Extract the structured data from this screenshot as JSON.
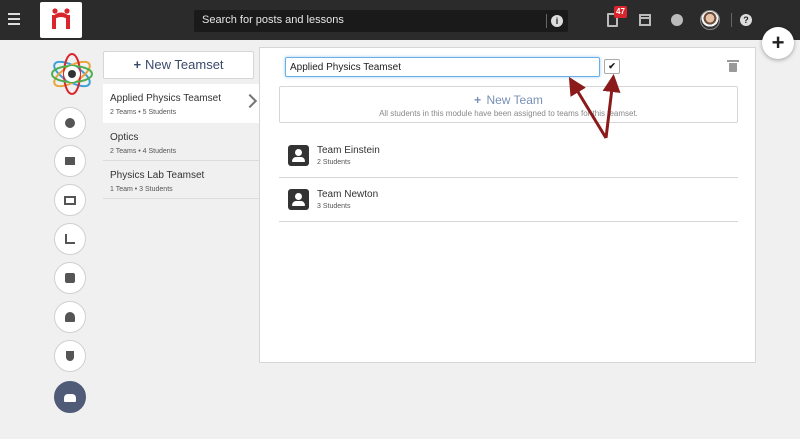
{
  "topbar": {
    "search_placeholder": "Search for posts and lessons",
    "notification_count": "47"
  },
  "fab": {
    "label": "+"
  },
  "teamsets": {
    "new_label": "New Teamset",
    "items": [
      {
        "name": "Applied Physics Teamset",
        "meta": "2 Teams • 5 Students"
      },
      {
        "name": "Optics",
        "meta": "2 Teams • 4 Students"
      },
      {
        "name": "Physics Lab Teamset",
        "meta": "1 Team • 3 Students"
      }
    ]
  },
  "editor": {
    "name_value": "Applied Physics Teamset",
    "new_team_label": "New Team",
    "new_team_note": "All students in this module have been assigned to teams for this teamset."
  },
  "teams": [
    {
      "name": "Team Einstein",
      "meta": "2 Students"
    },
    {
      "name": "Team Newton",
      "meta": "3 Students"
    }
  ],
  "colors": {
    "annotation_arrow": "#8b1a1a",
    "accent": "#4f5b77",
    "badge": "#d9262c"
  }
}
